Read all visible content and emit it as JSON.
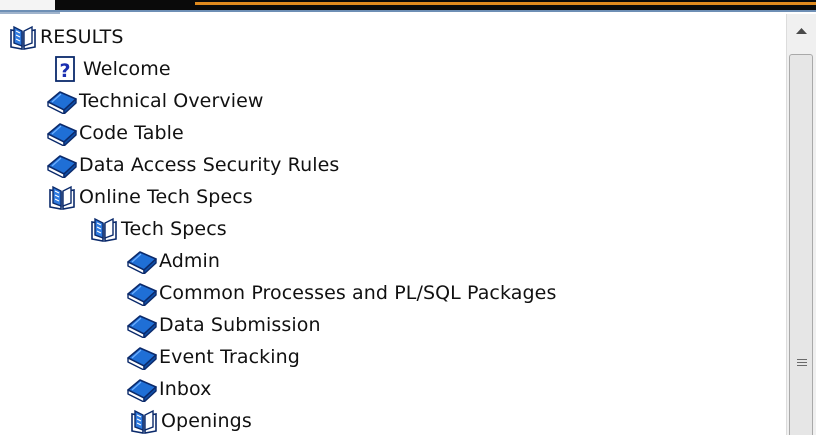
{
  "tree": {
    "root": {
      "label": "RESULTS",
      "icon": "open-book-icon"
    },
    "items": [
      {
        "label": "Welcome",
        "icon": "help-page-icon"
      },
      {
        "label": "Technical Overview",
        "icon": "closed-book-icon"
      },
      {
        "label": "Code Table",
        "icon": "closed-book-icon"
      },
      {
        "label": "Data Access Security Rules",
        "icon": "closed-book-icon"
      },
      {
        "label": "Online Tech Specs",
        "icon": "open-book-icon"
      },
      {
        "label": "Tech Specs",
        "icon": "open-book-icon"
      },
      {
        "label": "Admin",
        "icon": "closed-book-icon"
      },
      {
        "label": "Common Processes and PL/SQL Packages",
        "icon": "closed-book-icon"
      },
      {
        "label": "Data Submission",
        "icon": "closed-book-icon"
      },
      {
        "label": "Event Tracking",
        "icon": "closed-book-icon"
      },
      {
        "label": "Inbox",
        "icon": "closed-book-icon"
      },
      {
        "label": "Openings",
        "icon": "open-book-icon"
      }
    ]
  },
  "scrollbar": {
    "up_icon": "scroll-up-arrow-icon",
    "grip_icon": "grip-icon"
  },
  "colors": {
    "book_blue": "#1f6fd6",
    "book_outline": "#0b2a6b",
    "help_blue": "#1a2fb0",
    "accent_orange": "#e08a1e"
  }
}
